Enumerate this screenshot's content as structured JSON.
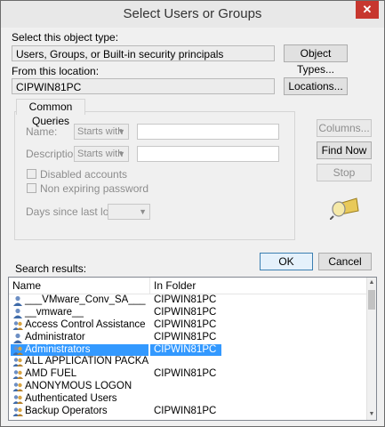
{
  "window": {
    "title": "Select Users or Groups",
    "close": "✕"
  },
  "object_type": {
    "label": "Select this object type:",
    "value": "Users, Groups, or Built-in security principals",
    "button": "Object Types..."
  },
  "location": {
    "label": "From this location:",
    "value": "CIPWIN81PC",
    "button": "Locations..."
  },
  "queries": {
    "tab": "Common Queries",
    "name_label": "Name:",
    "name_mode": "Starts with",
    "description_label": "Description:",
    "description_mode": "Starts with",
    "disabled_accounts": "Disabled accounts",
    "non_expiring": "Non expiring password",
    "days_label": "Days since last logon:"
  },
  "side_buttons": {
    "columns": "Columns...",
    "find_now": "Find Now",
    "stop": "Stop"
  },
  "dialog_buttons": {
    "ok": "OK",
    "cancel": "Cancel"
  },
  "results": {
    "label": "Search results:",
    "columns": [
      "Name",
      "In Folder"
    ],
    "rows": [
      {
        "name": "___VMware_Conv_SA___",
        "folder": "CIPWIN81PC",
        "icon": "user-icon"
      },
      {
        "name": "__vmware__",
        "folder": "CIPWIN81PC",
        "icon": "user-icon"
      },
      {
        "name": "Access Control Assistance Operat...",
        "folder": "CIPWIN81PC",
        "icon": "group-icon"
      },
      {
        "name": "Administrator",
        "folder": "CIPWIN81PC",
        "icon": "user-icon"
      },
      {
        "name": "Administrators",
        "folder": "CIPWIN81PC",
        "icon": "group-icon",
        "selected": true
      },
      {
        "name": "ALL APPLICATION PACKAGES",
        "folder": "",
        "icon": "group-icon"
      },
      {
        "name": "AMD FUEL",
        "folder": "CIPWIN81PC",
        "icon": "group-icon"
      },
      {
        "name": "ANONYMOUS LOGON",
        "folder": "",
        "icon": "group-icon"
      },
      {
        "name": "Authenticated Users",
        "folder": "",
        "icon": "group-icon"
      },
      {
        "name": "Backup Operators",
        "folder": "CIPWIN81PC",
        "icon": "group-icon"
      }
    ]
  },
  "colors": {
    "selection": "#3399ff",
    "close_button": "#c7372f",
    "ok_border": "#3c7fb1"
  }
}
